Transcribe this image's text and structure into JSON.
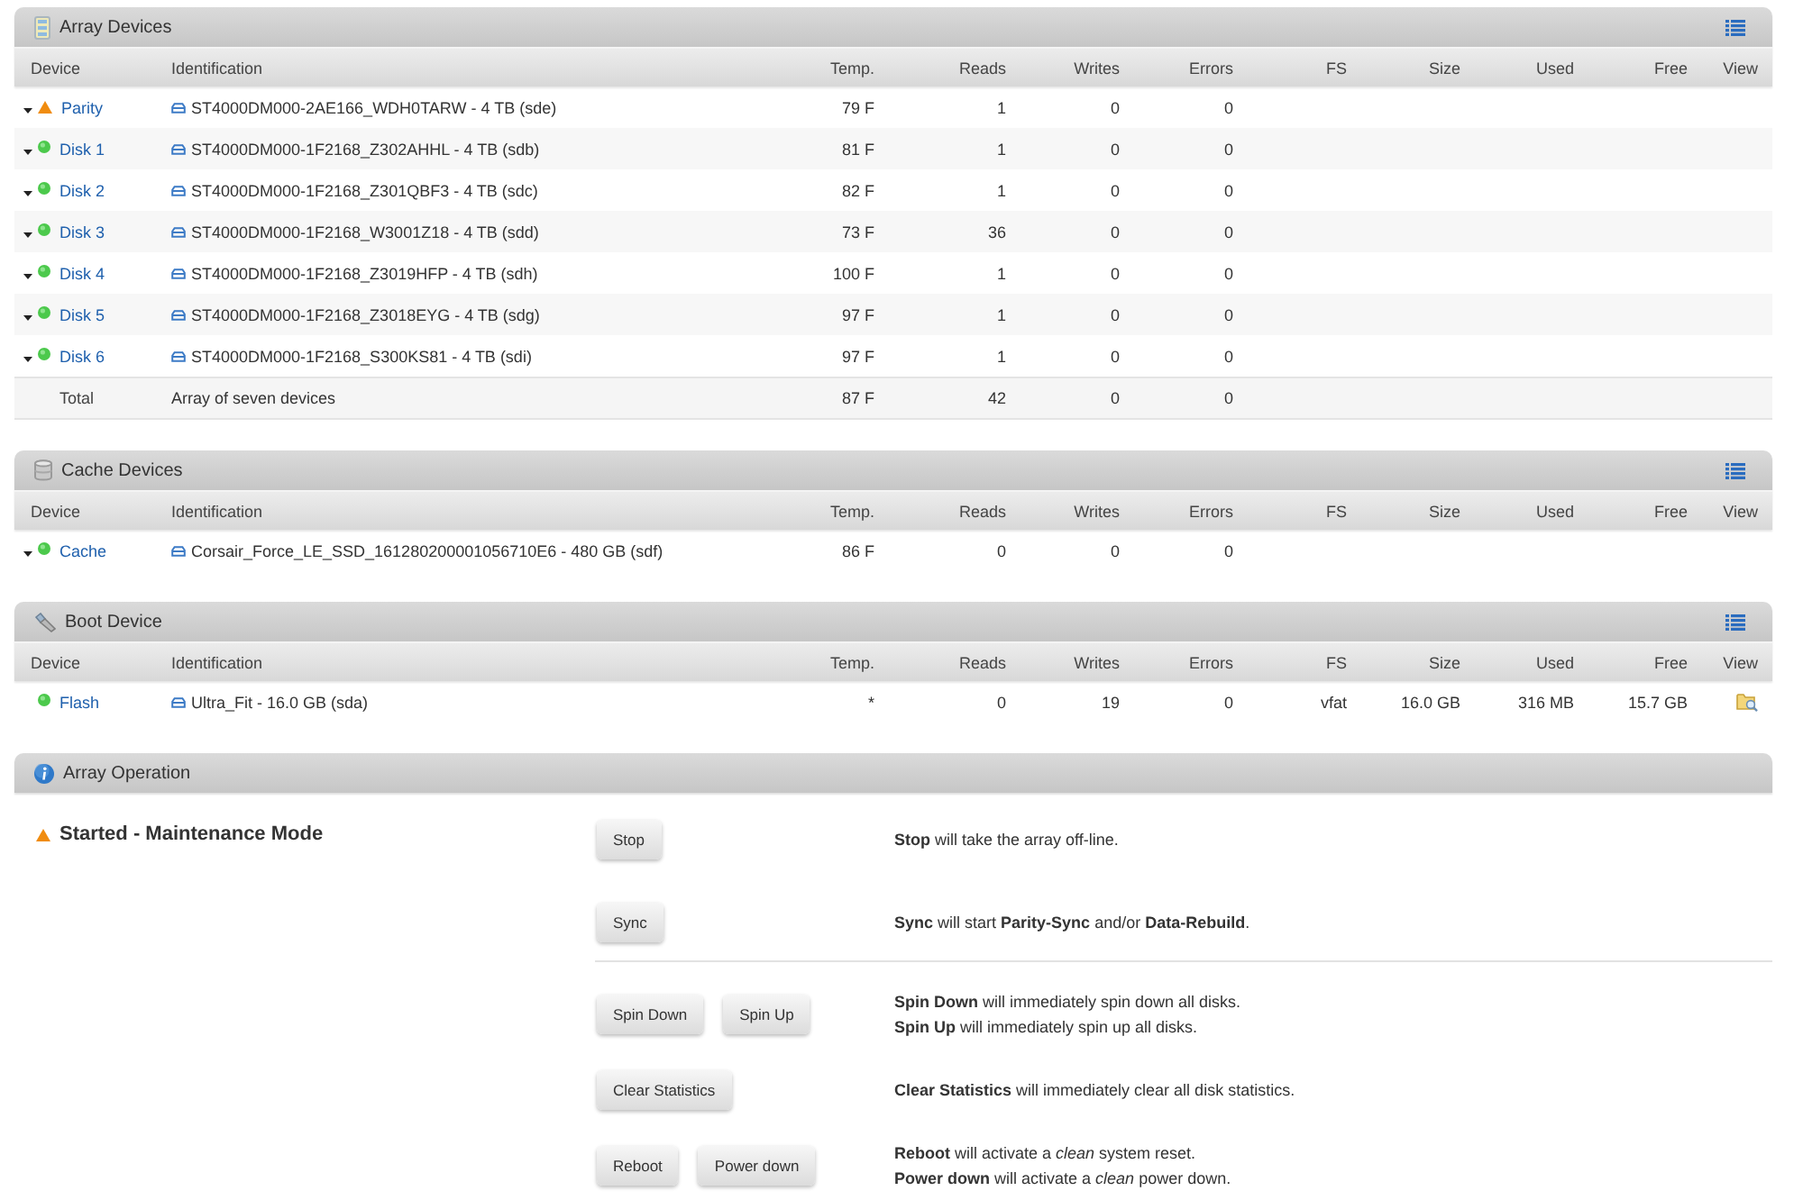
{
  "panels": [
    {
      "kind": "array",
      "title": "Array Devices",
      "columns": [
        "Device",
        "Identification",
        "Temp.",
        "Reads",
        "Writes",
        "Errors",
        "FS",
        "Size",
        "Used",
        "Free",
        "View"
      ],
      "devices": [
        {
          "name": "Parity",
          "warning": true,
          "expandable": true,
          "identification": "ST4000DM000-2AE166_WDH0TARW - 4 TB (sde)",
          "temp": "79 F",
          "reads": "1",
          "writes": "0",
          "errors": "0",
          "view": false
        },
        {
          "name": "Disk 1",
          "warning": false,
          "expandable": true,
          "identification": "ST4000DM000-1F2168_Z302AHHL - 4 TB (sdb)",
          "temp": "81 F",
          "reads": "1",
          "writes": "0",
          "errors": "0",
          "view": false
        },
        {
          "name": "Disk 2",
          "warning": false,
          "expandable": true,
          "identification": "ST4000DM000-1F2168_Z301QBF3 - 4 TB (sdc)",
          "temp": "82 F",
          "reads": "1",
          "writes": "0",
          "errors": "0",
          "view": false
        },
        {
          "name": "Disk 3",
          "warning": false,
          "expandable": true,
          "identification": "ST4000DM000-1F2168_W3001Z18 - 4 TB (sdd)",
          "temp": "73 F",
          "reads": "36",
          "writes": "0",
          "errors": "0",
          "view": false
        },
        {
          "name": "Disk 4",
          "warning": false,
          "expandable": true,
          "identification": "ST4000DM000-1F2168_Z3019HFP - 4 TB (sdh)",
          "temp": "100 F",
          "reads": "1",
          "writes": "0",
          "errors": "0",
          "view": false
        },
        {
          "name": "Disk 5",
          "warning": false,
          "expandable": true,
          "identification": "ST4000DM000-1F2168_Z3018EYG - 4 TB (sdg)",
          "temp": "97 F",
          "reads": "1",
          "writes": "0",
          "errors": "0",
          "view": false
        },
        {
          "name": "Disk 6",
          "warning": false,
          "expandable": true,
          "identification": "ST4000DM000-1F2168_S300KS81 - 4 TB (sdi)",
          "temp": "97 F",
          "reads": "1",
          "writes": "0",
          "errors": "0",
          "view": false
        }
      ],
      "total": {
        "label": "Total",
        "identification": "Array of seven devices",
        "temp": "87 F",
        "reads": "42",
        "writes": "0",
        "errors": "0"
      }
    },
    {
      "kind": "cache",
      "title": "Cache Devices",
      "columns": [
        "Device",
        "Identification",
        "Temp.",
        "Reads",
        "Writes",
        "Errors",
        "FS",
        "Size",
        "Used",
        "Free",
        "View"
      ],
      "devices": [
        {
          "name": "Cache",
          "warning": false,
          "expandable": true,
          "identification": "Corsair_Force_LE_SSD_161280200001056710E6 - 480 GB (sdf)",
          "temp": "86 F",
          "reads": "0",
          "writes": "0",
          "errors": "0",
          "view": false
        }
      ]
    },
    {
      "kind": "boot",
      "title": "Boot Device",
      "columns": [
        "Device",
        "Identification",
        "Temp.",
        "Reads",
        "Writes",
        "Errors",
        "FS",
        "Size",
        "Used",
        "Free",
        "View"
      ],
      "devices": [
        {
          "name": "Flash",
          "warning": false,
          "expandable": false,
          "identification": "Ultra_Fit - 16.0 GB (sda)",
          "temp": "*",
          "reads": "0",
          "writes": "19",
          "errors": "0",
          "fs": "vfat",
          "size": "16.0 GB",
          "used": "316 MB",
          "free": "15.7 GB",
          "view": true
        }
      ]
    }
  ],
  "operation": {
    "title": "Array Operation",
    "state": {
      "label": "Started - Maintenance Mode",
      "warning": true
    },
    "actions": [
      {
        "buttons": [
          "Stop"
        ],
        "lines": [
          "**Stop** will take the array off-line."
        ],
        "divider_above": false
      },
      {
        "buttons": [
          "Sync"
        ],
        "lines": [
          "**Sync** will start **Parity-Sync** and/or **Data-Rebuild**."
        ],
        "divider_above": false
      },
      {
        "buttons": [
          "Spin Down",
          "Spin Up"
        ],
        "lines": [
          "**Spin Down** will immediately spin down all disks.",
          "**Spin Up** will immediately spin up all disks."
        ],
        "divider_above": true
      },
      {
        "buttons": [
          "Clear Statistics"
        ],
        "lines": [
          "**Clear Statistics** will immediately clear all disk statistics."
        ],
        "divider_above": false
      },
      {
        "buttons": [
          "Reboot",
          "Power down"
        ],
        "lines": [
          "**Reboot** will activate a *clean* system reset.",
          "**Power down** will activate a *clean* power down."
        ],
        "divider_above": false
      }
    ]
  }
}
